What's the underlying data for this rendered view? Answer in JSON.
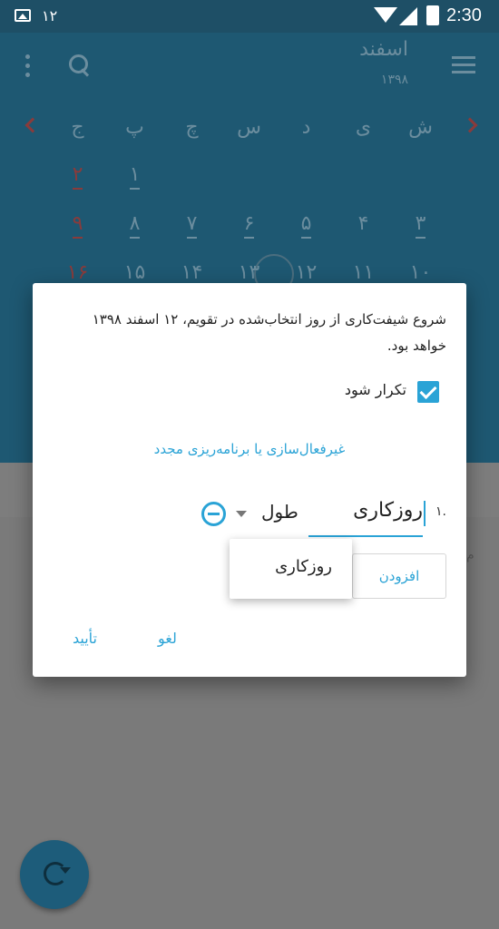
{
  "status_bar": {
    "notification_count": "۱۲",
    "time": "2:30",
    "icons": [
      "image-icon",
      "wifi-icon",
      "signal-icon",
      "battery-charging-icon"
    ]
  },
  "toolbar": {
    "month": "اسفند",
    "year": "۱۳۹۸",
    "icons": [
      "menu-icon",
      "search-icon",
      "more-vert-icon"
    ]
  },
  "calendar": {
    "weekdays": [
      "ش",
      "ی",
      "د",
      "س",
      "چ",
      "پ",
      "ج"
    ],
    "rows": [
      [
        "",
        "",
        "",
        "",
        "",
        "۱",
        "۲"
      ],
      [
        "۳",
        "۴",
        "۵",
        "۶",
        "۷",
        "۸",
        "۹"
      ],
      [
        "۱۰",
        "۱۱",
        "۱۲",
        "۱۳",
        "۱۴",
        "۱۵",
        "۱۶"
      ]
    ],
    "today": "۱۲",
    "holiday_color": "#c0392b"
  },
  "background": {
    "side_text": "م"
  },
  "dialog": {
    "message": "شروع شیفت‌کاری از روز انتخاب‌شده در تقویم، ۱۲ اسفند ۱۳۹۸ خواهد بود.",
    "repeat_label": "تکرار شود",
    "repeat_checked": true,
    "reschedule_link": "غیرفعال‌سازی یا برنامه‌ریزی مجدد",
    "row_number": "۱.",
    "shift_type_value": "روزکاری",
    "length_label": "طول",
    "add_label": "افزودن",
    "dropdown_options": [
      "روزکاری"
    ],
    "cancel_label": "لغو",
    "confirm_label": "تأیید"
  },
  "colors": {
    "accent": "#2aa3d6",
    "header_dimmed": "#1e5872",
    "scrim": "#7a7a7a"
  }
}
